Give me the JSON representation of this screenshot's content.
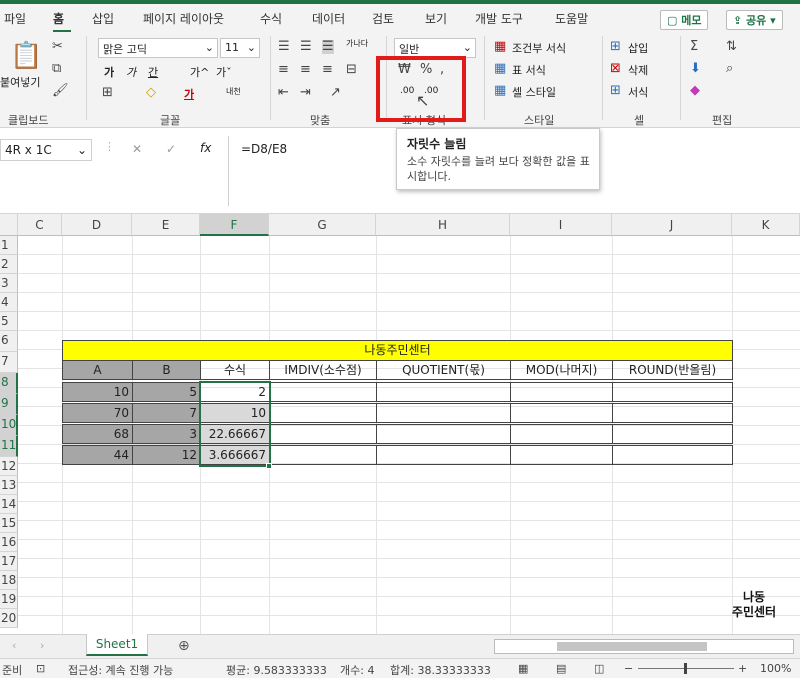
{
  "tabs": [
    "파일",
    "홈",
    "삽입",
    "페이지 레이아웃",
    "수식",
    "데이터",
    "검토",
    "보기",
    "개발 도구",
    "도움말"
  ],
  "top_buttons": {
    "memo": "메모",
    "share": "공유"
  },
  "ribbon": {
    "clipboard": {
      "paste": "붙여넣기",
      "label": "클립보드"
    },
    "font": {
      "name": "맑은 고딕",
      "size": "11",
      "label": "글꼴",
      "bold": "가",
      "italic": "가",
      "underline": "간",
      "grow": "가^",
      "shrink": "가ˇ",
      "fontcolor": "가",
      "phonetic": "내천"
    },
    "alignment": {
      "label": "맞춤",
      "wrap": "가나다"
    },
    "number": {
      "format": "일반",
      "label": "표시 형식",
      "inc_label": ".00"
    },
    "styles": {
      "conditional": "조건부 서식",
      "table": "표 서식",
      "cell": "셀 스타일",
      "label": "스타일"
    },
    "cells": {
      "insert": "삽입",
      "delete": "삭제",
      "format": "서식",
      "label": "셀"
    },
    "editing": {
      "label": "편집"
    }
  },
  "tooltip": {
    "title": "자릿수 늘림",
    "body": "소수 자릿수를 늘려 보다 정확한 값을 표시합니다."
  },
  "formula_bar": {
    "name_box": "4R x 1C",
    "cancel": "✕",
    "enter": "✓",
    "fx": "fx",
    "formula": "=D8/E8"
  },
  "columns": [
    "C",
    "D",
    "E",
    "F",
    "G",
    "H",
    "I",
    "J",
    "K"
  ],
  "rows": [
    "1",
    "2",
    "3",
    "4",
    "5",
    "6",
    "7",
    "8",
    "9",
    "10",
    "11",
    "12",
    "13",
    "14",
    "15",
    "16",
    "17",
    "18",
    "19",
    "20"
  ],
  "sheet": {
    "title": "나동주민센터",
    "headers": [
      "A",
      "B",
      "수식",
      "IMDIV(소수점)",
      "QUOTIENT(몫)",
      "MOD(나머지)",
      "ROUND(반올림)"
    ],
    "data": [
      [
        "10",
        "5",
        "2"
      ],
      [
        "70",
        "7",
        "10"
      ],
      [
        "68",
        "3",
        "22.66667"
      ],
      [
        "44",
        "12",
        "3.666667"
      ]
    ]
  },
  "sheet_tab": "Sheet1",
  "status": {
    "mode": "준비",
    "accessibility": "접근성: 계속 진행 가능",
    "average": "평균: 9.583333333",
    "count": "개수: 4",
    "sum": "합계: 38.33333333",
    "zoom": "100%"
  },
  "watermark": {
    "line1": "나동",
    "line2": "주민센터"
  },
  "colors": {
    "excel_green": "#217346",
    "title_fill": "#ffff00",
    "header_fill": "#a6a6a6",
    "highlight_red": "#e21a1a"
  }
}
